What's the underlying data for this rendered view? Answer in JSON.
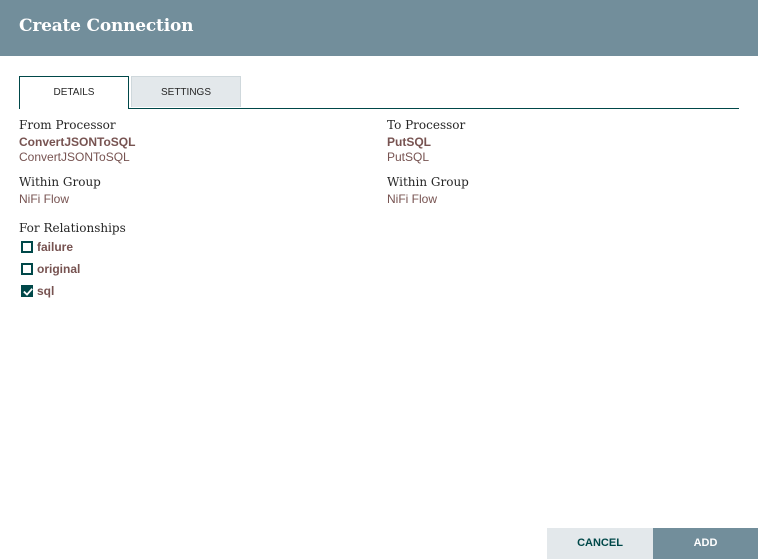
{
  "dialog": {
    "title": "Create Connection"
  },
  "tabs": [
    {
      "label": "DETAILS",
      "active": true
    },
    {
      "label": "SETTINGS",
      "active": false
    }
  ],
  "from": {
    "label": "From Processor",
    "name": "ConvertJSONToSQL",
    "type": "ConvertJSONToSQL",
    "group_label": "Within Group",
    "group": "NiFi Flow"
  },
  "to": {
    "label": "To Processor",
    "name": "PutSQL",
    "type": "PutSQL",
    "group_label": "Within Group",
    "group": "NiFi Flow"
  },
  "relationships": {
    "label": "For Relationships",
    "items": [
      {
        "label": "failure",
        "checked": false
      },
      {
        "label": "original",
        "checked": false
      },
      {
        "label": "sql",
        "checked": true
      }
    ]
  },
  "buttons": {
    "cancel": "CANCEL",
    "add": "ADD"
  },
  "colors": {
    "header_bg": "#728e9b",
    "accent": "#004849",
    "value_text": "#775351",
    "secondary_button_bg": "#e3e8eb"
  }
}
